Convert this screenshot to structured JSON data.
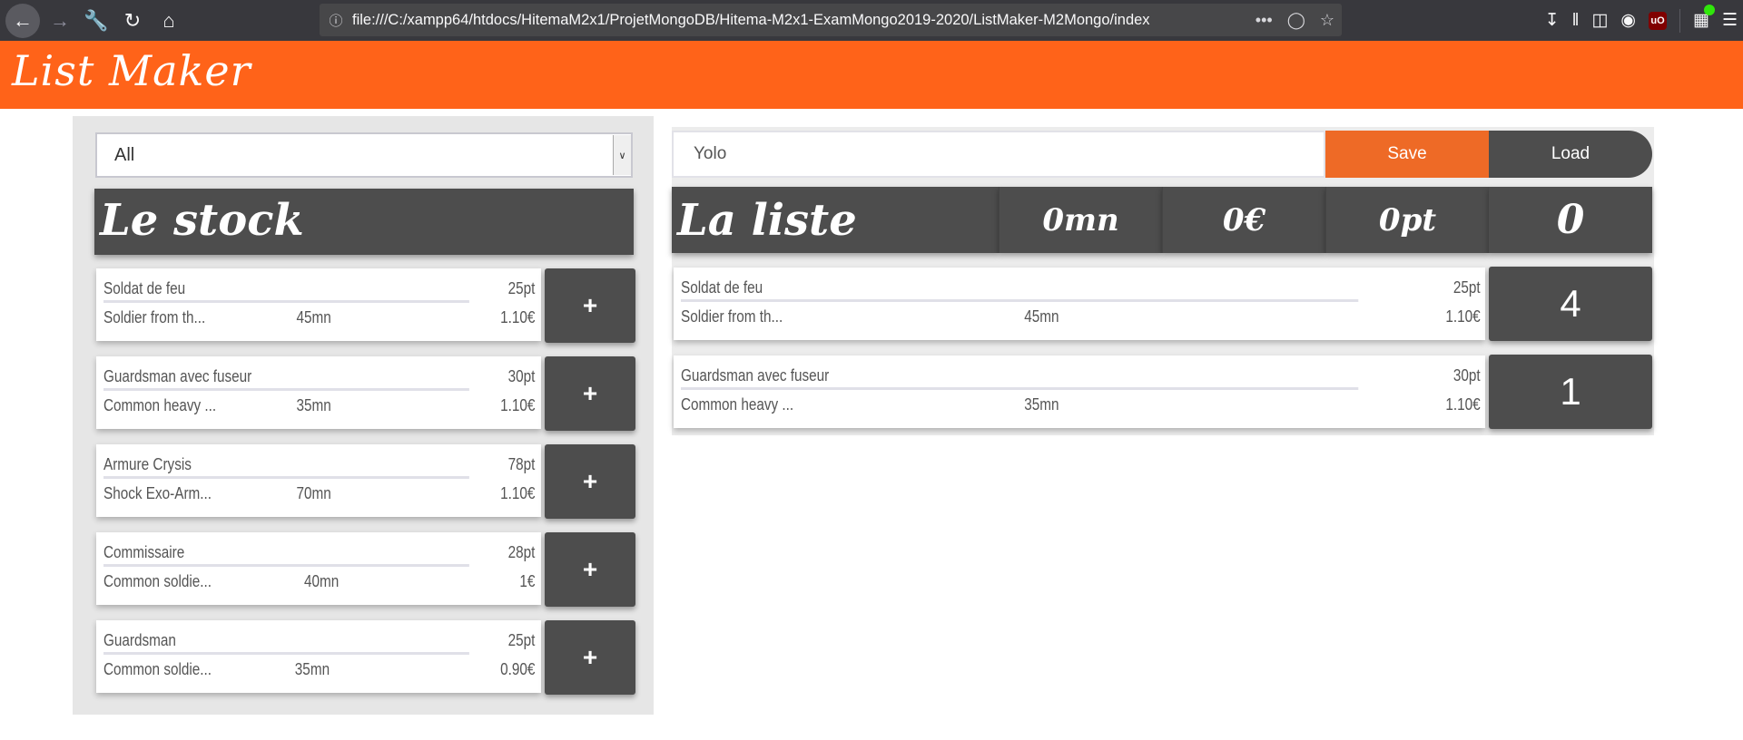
{
  "browser": {
    "url": "file:///C:/xampp64/htdocs/HitemaM2x1/ProjetMongoDB/Hitema-M2x1-ExamMongo2019-2020/ListMaker-M2Mongo/index",
    "page_actions": "•••"
  },
  "app": {
    "title": "List Maker"
  },
  "stock": {
    "filter_value": "All",
    "heading": "Le stock",
    "add_label": "+",
    "items": [
      {
        "name": "Soldat de feu",
        "pt": "25pt",
        "desc": "Soldier from th...",
        "time": "45mn",
        "price": "1.10€"
      },
      {
        "name": "Guardsman avec fuseur",
        "pt": "30pt",
        "desc": "Common heavy ...",
        "time": "35mn",
        "price": "1.10€"
      },
      {
        "name": "Armure Crysis",
        "pt": "78pt",
        "desc": "Shock Exo-Arm...",
        "time": "70mn",
        "price": "1.10€"
      },
      {
        "name": "Commissaire",
        "pt": "28pt",
        "desc": "Common soldie...",
        "time": "40mn",
        "price": "1€"
      },
      {
        "name": "Guardsman",
        "pt": "25pt",
        "desc": "Common soldie...",
        "time": "35mn",
        "price": "0.90€"
      }
    ]
  },
  "liste": {
    "name_value": "Yolo",
    "save_label": "Save",
    "load_label": "Load",
    "heading": "La liste",
    "total_time": "0mn",
    "total_price": "0€",
    "total_points": "0pt",
    "total_count": "0",
    "items": [
      {
        "name": "Soldat de feu",
        "pt": "25pt",
        "desc": "Soldier from th...",
        "time": "45mn",
        "price": "1.10€",
        "qty": "4"
      },
      {
        "name": "Guardsman avec fuseur",
        "pt": "30pt",
        "desc": "Common heavy ...",
        "time": "35mn",
        "price": "1.10€",
        "qty": "1"
      }
    ]
  },
  "colors": {
    "brand_orange": "#ff6319",
    "save_orange": "#ee6a26",
    "dark_panel": "#4d4d4d"
  }
}
